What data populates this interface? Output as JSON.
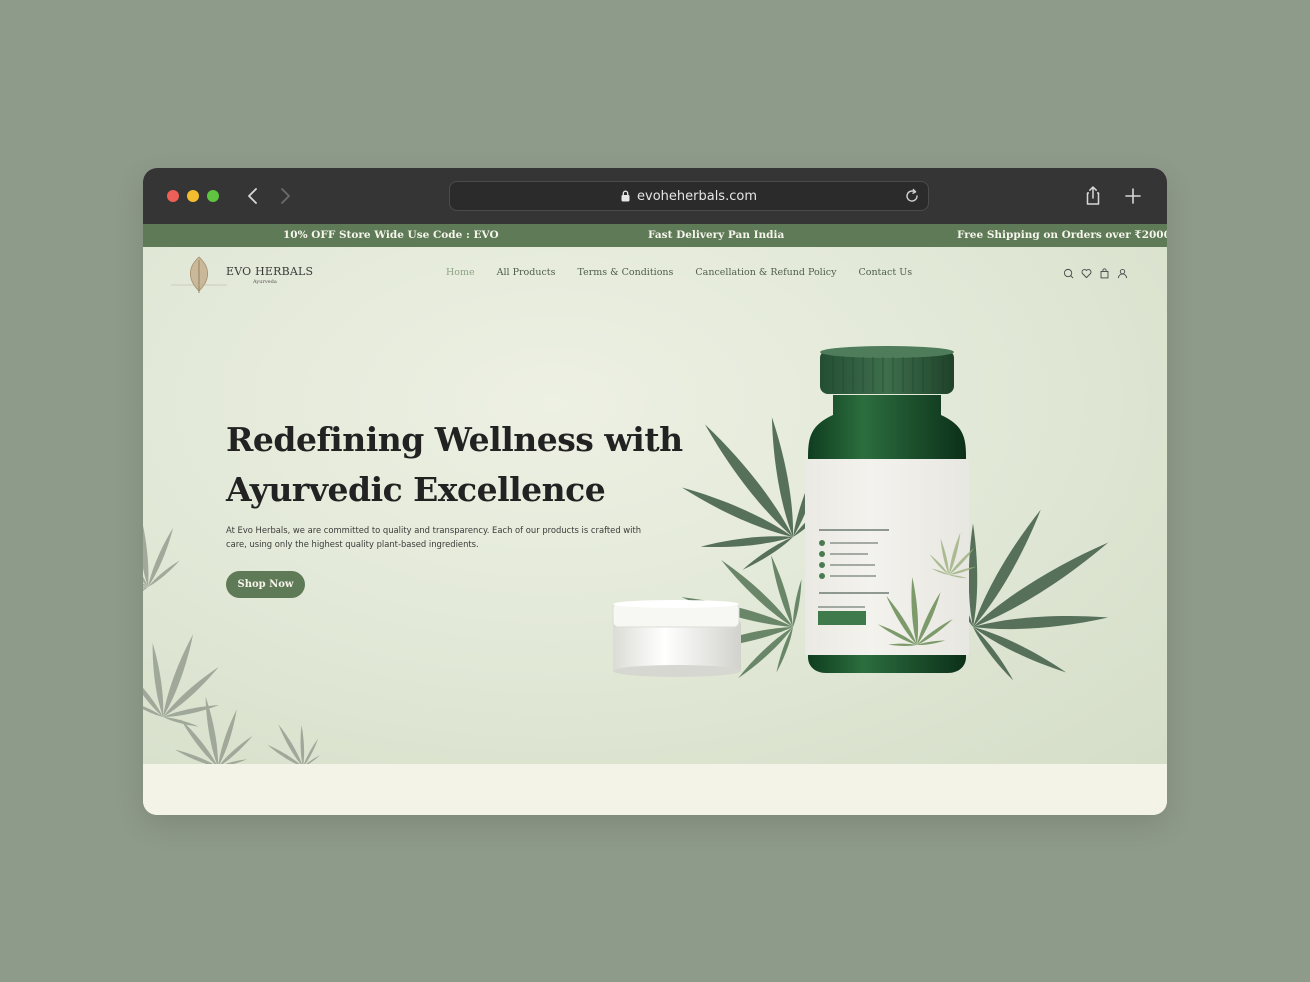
{
  "browser": {
    "url": "evoheherbals.com"
  },
  "announcement": {
    "item1": "10% OFF Store Wide Use Code : EVO",
    "item2": "Fast Delivery Pan India",
    "item3": "Free Shipping on Orders over ₹2000"
  },
  "brand": {
    "name": "EVO HERBALS",
    "tagline": "Ayurveda"
  },
  "nav": {
    "home": "Home",
    "all_products": "All Products",
    "terms": "Terms & Conditions",
    "refund": "Cancellation & Refund Policy",
    "contact": "Contact Us"
  },
  "header_icons": [
    "search-icon",
    "heart-icon",
    "bag-icon",
    "user-icon"
  ],
  "hero": {
    "title_line1": "Redefining Wellness with",
    "title_line2": "Ayurvedic Excellence",
    "description": "At Evo Herbals, we are committed to quality and transparency. Each of our products is crafted with care, using only the highest quality plant-based ingredients.",
    "cta": "Shop Now"
  },
  "colors": {
    "accent": "#5f7a57",
    "background": "#8f9b8a",
    "titlebar": "#353535"
  }
}
